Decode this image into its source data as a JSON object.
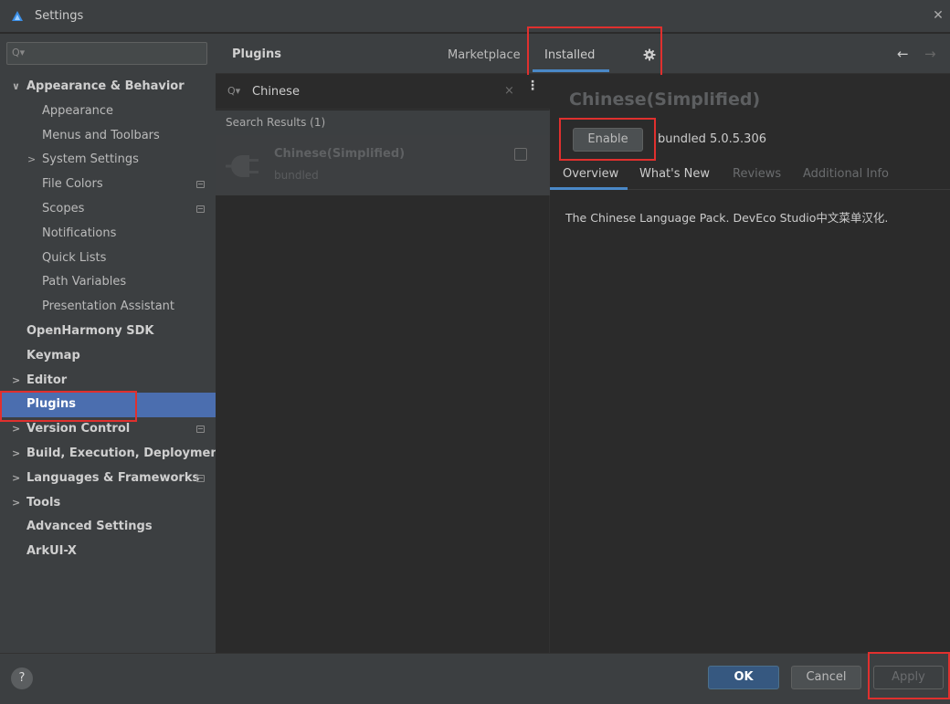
{
  "window": {
    "title": "Settings",
    "close_glyph": "✕"
  },
  "nav": {
    "search_glyph": "Q▾",
    "items": [
      {
        "label": "Appearance & Behavior",
        "expander": "∨",
        "bold": true
      },
      {
        "label": "Appearance"
      },
      {
        "label": "Menus and Toolbars"
      },
      {
        "label": "System Settings",
        "expander": ">"
      },
      {
        "label": "File Colors",
        "has_icon": true
      },
      {
        "label": "Scopes",
        "has_icon": true
      },
      {
        "label": "Notifications"
      },
      {
        "label": "Quick Lists"
      },
      {
        "label": "Path Variables"
      },
      {
        "label": "Presentation Assistant"
      },
      {
        "label": "OpenHarmony SDK",
        "bold": true
      },
      {
        "label": "Keymap",
        "bold": true
      },
      {
        "label": "Editor",
        "expander": ">",
        "bold": true
      },
      {
        "label": "Plugins",
        "bold": true,
        "selected": true
      },
      {
        "label": "Version Control",
        "expander": ">",
        "bold": true,
        "has_icon": true
      },
      {
        "label": "Build, Execution, Deployment",
        "expander": ">",
        "bold": true
      },
      {
        "label": "Languages & Frameworks",
        "expander": ">",
        "bold": true,
        "has_icon": true
      },
      {
        "label": "Tools",
        "expander": ">",
        "bold": true
      },
      {
        "label": "Advanced Settings",
        "bold": true
      },
      {
        "label": "ArkUI-X",
        "bold": true
      }
    ]
  },
  "plugins_header": {
    "title": "Plugins",
    "tab_marketplace": "Marketplace",
    "tab_installed": "Installed",
    "back_glyph": "←",
    "forward_glyph": "→"
  },
  "search": {
    "icon_glyph": "Q▾",
    "value": "Chinese",
    "clear_glyph": "×",
    "more_glyph": "⋮"
  },
  "results": {
    "header": "Search Results (1)",
    "plugin": {
      "name": "Chinese(Simplified)",
      "subtitle": "bundled"
    }
  },
  "detail": {
    "title": "Chinese(Simplified)",
    "enable_label": "Enable",
    "version": "bundled 5.0.5.306",
    "tabs": [
      "Overview",
      "What's New",
      "Reviews",
      "Additional Info"
    ],
    "description": "The Chinese Language Pack. DevEco Studio中文菜单汉化."
  },
  "footer": {
    "help_label": "?",
    "ok_label": "OK",
    "cancel_label": "Cancel",
    "apply_label": "Apply"
  },
  "colors": {
    "accent": "#4b6eaf",
    "highlight_box": "#e0302e",
    "tab_underline": "#4a88c7"
  }
}
